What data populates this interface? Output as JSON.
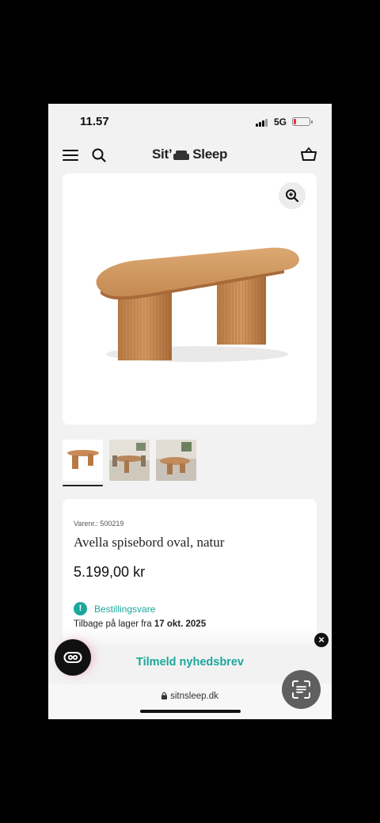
{
  "status_bar": {
    "time": "11.57",
    "network": "5G",
    "battery_level": 0.15
  },
  "header": {
    "logo_left": "Sit’",
    "logo_right": "Sleep",
    "icons": [
      "menu-icon",
      "search-icon",
      "sofa-logo-icon",
      "basket-icon"
    ]
  },
  "product": {
    "sku": "Varenr.: 500219",
    "title": "Avella spisebord oval, natur",
    "price": "5.199,00 kr",
    "availability": "Bestillingsvare",
    "availability_icon": "!",
    "restock_text": "Tilbage på lager fra",
    "restock_date": "17 okt. 2025"
  },
  "gallery": {
    "thumbnail_count": 3,
    "active_index": 0
  },
  "newsletter": {
    "label": "Tilmeld nyhedsbrev"
  },
  "browser": {
    "url": "sitnsleep.dk"
  },
  "colors": {
    "accent": "#1aa89b",
    "background": "#f2f2f2",
    "wood": "#c98a55"
  }
}
